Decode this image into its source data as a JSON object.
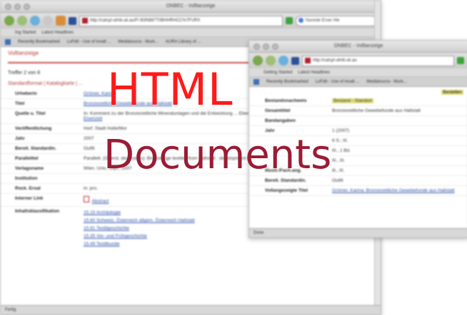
{
  "window1": {
    "title": "ONBEC - Volltanzeige",
    "url": "http://catsyl-ulmb.uk.au/F/-B3N887T0BHHRHCC%7FURX",
    "search_placeholder": "Yasrede Erser Hie",
    "bookmarks": [
      "Ing Started",
      "Latest Headlines"
    ],
    "tabs": [
      "Recently Bookmarked",
      "LoFdit - Use of invalt ...",
      "Mediatsucra - Murk...",
      "AURA Library of ..."
    ],
    "heading": "Volltanzeige",
    "record_line": "Treffer 2 von 8",
    "format_links": "Standardformat | Katalogkarte | ...",
    "status_text": "Fertig",
    "rows": [
      {
        "k": "Urheberin",
        "v": "Grömer, Karina"
      },
      {
        "k": "Titel",
        "v": "Bronzezeitliche Gewebefunde aus Hallstatt"
      },
      {
        "k": "Quelle u. Titel",
        "v": "In: Komment zu der Bronzezeitliche Mineralunlagen und die Entwicklung ... Ebenso",
        "v2": "Eisenzeit"
      },
      {
        "k": "Veröffentlichung",
        "v": "Horf. Stadt Holle/Mor"
      },
      {
        "k": "Jahr",
        "v": "2007"
      },
      {
        "k": "Bereit. Standardin.",
        "v": "Outfit"
      },
      {
        "k": "Parallelitel",
        "v": "Parallelt. (Oberst. des Autors): Bronze Age textiles from Hallstatt : development of textile technology from bronze age to iron age"
      },
      {
        "k": "Verlagsname",
        "v": "Wien. Univ., Dipl., 2007"
      },
      {
        "k": "Institution",
        "v": ""
      },
      {
        "k": "Rock. Ersat",
        "v": "in: pro."
      },
      {
        "k": "Interner Link",
        "v": "Abstract"
      }
    ],
    "classification_label": "Inhaltsklassifikation",
    "classification_items": [
      "15.15 Archäologie",
      "15.60 Schweiz, Österreich allgem.  Österreich  Hallstatt",
      "15.91 Textilgeschichte",
      "15.35 Vor- und Frühgeschichte",
      "15.49 Textilkunde"
    ]
  },
  "window2": {
    "title": "ONBEC - Volltanzeige",
    "url": "http://catsyl-ulmb.uk.au",
    "bookmarks": [
      "Getting Started",
      "Latest Headlines"
    ],
    "tabs": [
      "Recently Bookmarked",
      "LoFdit - Use of invalt ...",
      "Mediatsucra - Murk..."
    ],
    "badge": "Bestellen",
    "rows": [
      {
        "k": "Bestandsnachweis",
        "v": "Bestand - Standort",
        "hl": true
      },
      {
        "k": "Gesamttitel",
        "v": "Bronzezeitliche Gewebefunde aus Hallstatt"
      },
      {
        "k": "Bandangaben",
        "v": ""
      },
      {
        "k": "Jahr",
        "v": "1 (2007)"
      },
      {
        "k": "",
        "v": "6 S.; III."
      },
      {
        "k": "",
        "v": "III., 1 Bd."
      },
      {
        "k": "",
        "v": "III., III."
      },
      {
        "k": "Illustr./Fach.ang.",
        "v": "Ill., III."
      },
      {
        "k": "Bereit. Standardin.",
        "v": "Outfit"
      },
      {
        "k": "Vollangezeigte Titel",
        "v": "Grömer, Karina: Bronzezeitliche Gewebefunde aus Hallstatt"
      }
    ],
    "status_text": "Done"
  },
  "overlay": {
    "line1": "HTML",
    "line2": "Documents",
    "color1": "#ff1a1a",
    "color2": "#9b1b34"
  }
}
